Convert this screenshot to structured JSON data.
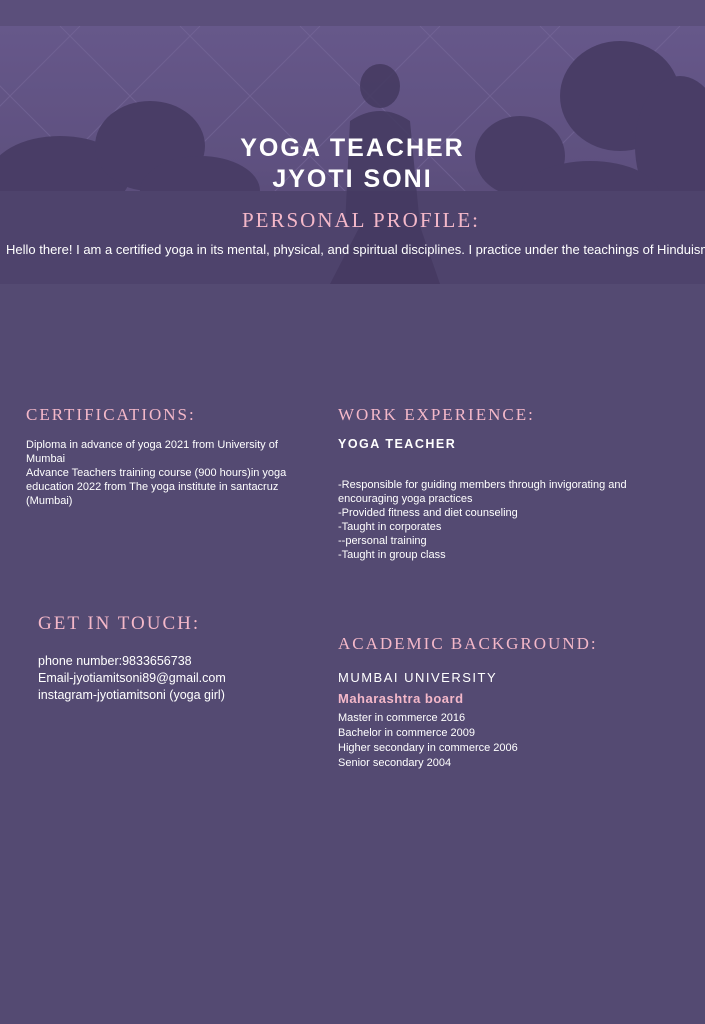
{
  "header": {
    "title_line1": "YOGA TEACHER",
    "title_line2": "JYOTI SONI"
  },
  "profile": {
    "heading": "PERSONAL PROFILE:",
    "text": "Hello there! I am a certified yoga  in its mental, physical, and spiritual disciplines. I practice under the teachings of Hinduism"
  },
  "certifications": {
    "heading": "CERTIFICATIONS:",
    "lines": [
      "Diploma in advance of yoga 2021 from University of",
      "Mumbai",
      "Advance Teachers training course (900 hours)in yoga",
      "education 2022 from The yoga institute in santacruz",
      "(Mumbai)"
    ]
  },
  "work": {
    "heading": "WORK EXPERIENCE:",
    "role": "YOGA TEACHER",
    "lines": [
      "-Responsible for guiding members through invigorating and",
      "encouraging yoga practices",
      "-Provided fitness and diet counseling",
      "-Taught in corporates",
      "--personal training",
      "-Taught in group class"
    ]
  },
  "contact": {
    "heading": "GET IN TOUCH:",
    "lines": [
      "phone number:9833656738",
      "Email-jyotiamitsoni89@gmail.com",
      "instagram-jyotiamitsoni (yoga girl)"
    ]
  },
  "academic": {
    "heading": "ACADEMIC BACKGROUND:",
    "university": "MUMBAI UNIVERSITY",
    "board": "Maharashtra board",
    "lines": [
      "Master in commerce 2016",
      "Bachelor in commerce 2009",
      "Higher secondary in commerce 2006",
      "Senior secondary 2004"
    ]
  }
}
